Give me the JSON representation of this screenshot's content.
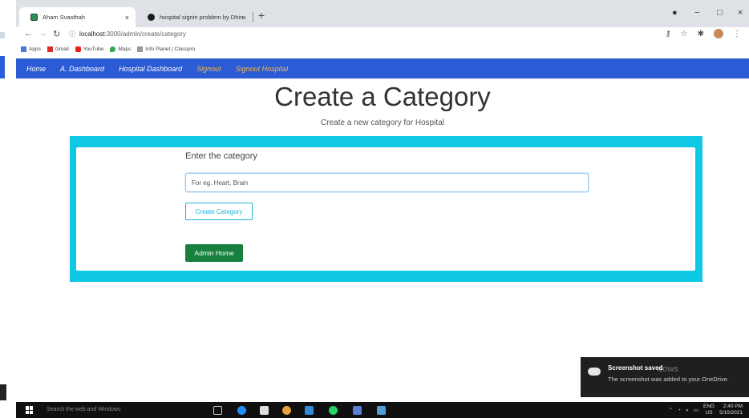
{
  "browser": {
    "tabs": [
      {
        "title": "Aham Svasthah",
        "close": "×",
        "active": true
      },
      {
        "title": "hospital signin problem by Dhin",
        "close": "×",
        "active": false
      }
    ],
    "new_tab": "+",
    "window_controls": {
      "minimize": "−",
      "maximize": "□",
      "close": "×"
    },
    "url_host": "localhost",
    "url_path": ":3000/admin/create/category",
    "bookmarks": [
      "Apps",
      "Gmail",
      "YouTube",
      "Maps",
      "Info Planet | Classpro"
    ]
  },
  "appnav": {
    "items": [
      {
        "label": "Home"
      },
      {
        "label": "A. Dashboard"
      },
      {
        "label": "Hospital Dashboard"
      },
      {
        "label": "Signout"
      },
      {
        "label": "Signout Hospital"
      }
    ]
  },
  "page": {
    "title": "Create a Category",
    "subtitle": "Create a new category for Hospital",
    "field_label": "Enter the category",
    "input_placeholder": "For eg. Heart, Brain",
    "input_value": "",
    "create_button": "Create Category",
    "admin_home_button": "Admin Home"
  },
  "toast": {
    "title": "Screenshot saved",
    "body": "The screenshot was added to your OneDrive.",
    "ghost_text": "dows"
  },
  "taskbar": {
    "search_placeholder": "Search the web and Windows",
    "lang_top": "ENG",
    "lang_bottom": "US",
    "time": "2:40 PM",
    "date": "5/10/2021"
  },
  "colors": {
    "nav_bg": "#2c5bd6",
    "accent_cyan": "#0fc8e6",
    "success_green": "#17803f",
    "warning_text": "#f0b84a"
  }
}
